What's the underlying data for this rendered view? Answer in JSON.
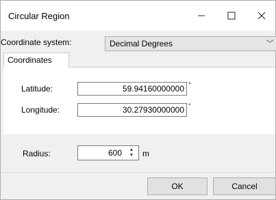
{
  "window": {
    "title": "Circular Region"
  },
  "coordinate_system": {
    "label": "Coordinate system:",
    "value": "Decimal Degrees"
  },
  "tabs": [
    {
      "label": "Coordinates"
    }
  ],
  "latitude": {
    "label": "Latitude:",
    "value": "59.94160000000",
    "unit": "°"
  },
  "longitude": {
    "label": "Longitude:",
    "value": "30.27930000000",
    "unit": "°"
  },
  "radius": {
    "label": "Radius:",
    "value": "600",
    "unit": "m"
  },
  "buttons": {
    "ok": "OK",
    "cancel": "Cancel"
  },
  "icons": {
    "minimize": "minimize-icon",
    "maximize": "maximize-icon",
    "close": "close-icon",
    "dropdown": "chevron-down-icon",
    "spinner": "spinner-arrows-icon"
  }
}
